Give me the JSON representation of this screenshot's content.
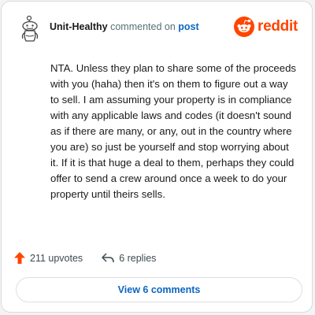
{
  "comment": {
    "username": "Unit-Healthy",
    "action_text": "commented on",
    "target_link": "post",
    "body": "NTA. Unless they plan to share some of the proceeds with you (haha) then it's on them to figure out a way to sell. I am assuming your property is in compliance with any applicable laws and codes (it doesn't sound as if there are many, or any, out in the country where you are) so just be yourself and stop worrying about it. If it is that huge a deal to them, perhaps they could offer to send a crew around once a week to do your property until theirs sells."
  },
  "brand": {
    "wordmark": "reddit",
    "icon": "reddit-logo-icon",
    "color": "#ff4500"
  },
  "stats": {
    "upvotes_label": "211 upvotes",
    "upvote_icon": "upvote-arrow-icon",
    "replies_label": "6 replies",
    "reply_icon": "reply-arrow-icon"
  },
  "footer": {
    "view_comments_label": "View 6 comments"
  },
  "colors": {
    "accent": "#ff4500",
    "link": "#0a66c2"
  }
}
